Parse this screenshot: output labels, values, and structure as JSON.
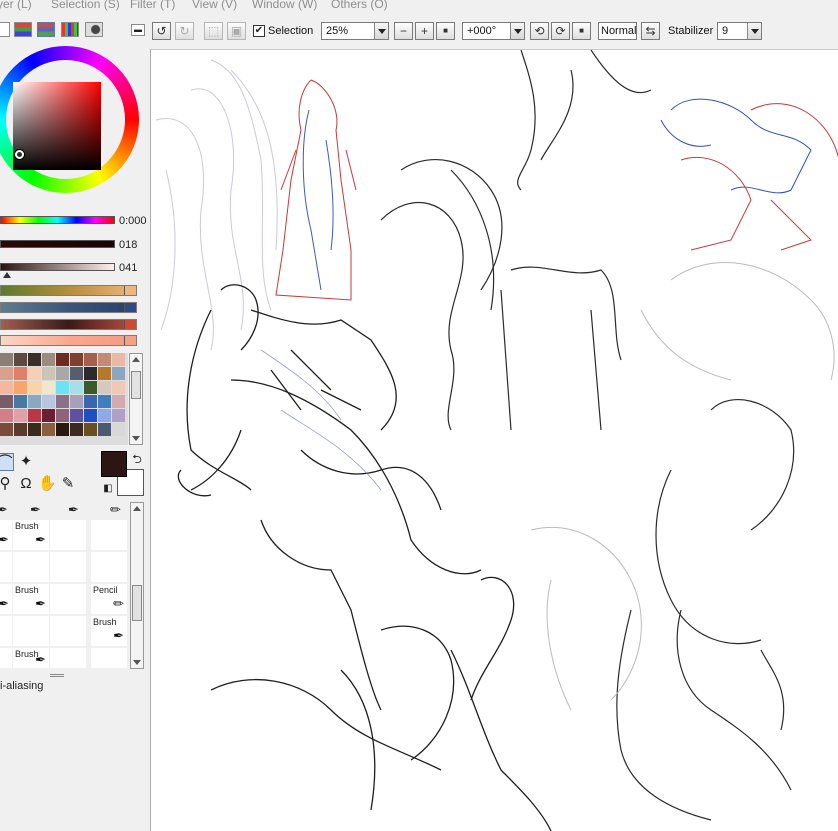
{
  "menu": {
    "items": [
      "yer (L)",
      "Selection (S)",
      "Filter (T)",
      "View (V)",
      "Window (W)",
      "Others (O)"
    ]
  },
  "color_panel": {
    "sliders": [
      {
        "name": "hue",
        "value": "0:000"
      },
      {
        "name": "saturation",
        "value": "018"
      },
      {
        "name": "value",
        "value": "041"
      }
    ],
    "foreground_color": "#2b1614",
    "background_color": "#ffffff"
  },
  "swatches": {
    "colors": [
      "#8b7e74",
      "#5a4a42",
      "#3b2f2a",
      "#9c8c80",
      "#6d2b22",
      "#804030",
      "#a65e4e",
      "#c58a77",
      "#e8b9a4",
      "#d9a08a",
      "#e0806a",
      "#f6d0b5",
      "#cdc4b8",
      "#a8a8a8",
      "#555e6b",
      "#2b2b2b",
      "#b8782c",
      "#8aa6c0",
      "#f3b89e",
      "#f7a46e",
      "#f9d4a6",
      "#f2e6cf",
      "#6be3f0",
      "#a6dfea",
      "#3a5a2a",
      "#d8c9c0",
      "#f0c9b2",
      "#7b5a6a",
      "#4b78a0",
      "#8aa8c0",
      "#b8c6e0",
      "#8a7088",
      "#a8a0b8",
      "#3a66b0",
      "#3f7fbf",
      "#d4aab0",
      "#d28088",
      "#e0a0a8",
      "#b83848",
      "#6a2030",
      "#8e6478",
      "#6050a0",
      "#2050c0",
      "#90a8e8",
      "#b0a0c8",
      "#7a4a3a",
      "#5a3a2a",
      "#3a2a1a",
      "#8a6040",
      "#2a1810",
      "#3a2a20",
      "#6a5020",
      "#4a5a70",
      "#d8d8d8"
    ]
  },
  "brush_panel": {
    "cells": [
      "Brush",
      "",
      "",
      "",
      "Brush",
      "",
      "Pencil",
      "Brush",
      "",
      "Brush"
    ]
  },
  "antialiasing_label": "i-aliasing",
  "toolbar": {
    "selection_label": "Selection",
    "selection_checked": true,
    "zoom": "25%",
    "rotation": "+000°",
    "blend_mode": "Normal",
    "stabilizer_label": "Stabilizer",
    "stabilizer_value": "9"
  }
}
